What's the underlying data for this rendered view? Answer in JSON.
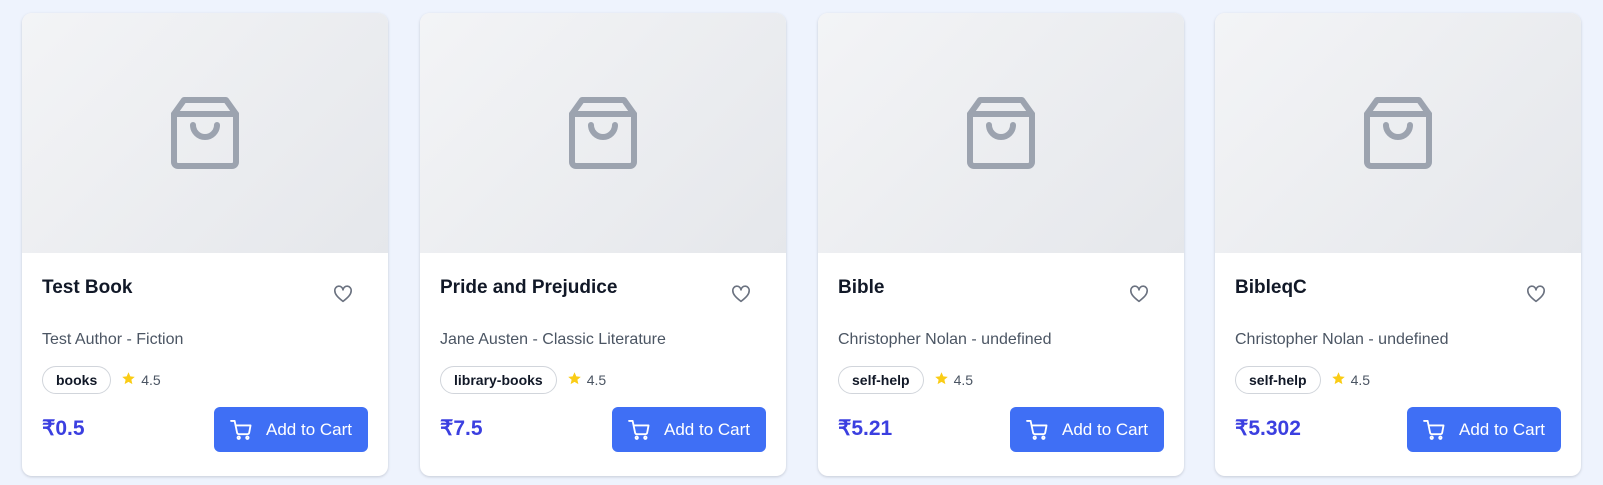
{
  "colors": {
    "page_background": "#eef3fd",
    "accent": "#3f6ff5",
    "price": "#3b3fe0",
    "star": "#facc15",
    "placeholder_icon": "#9ca3af"
  },
  "icons": {
    "placeholder": "shopping-bag-icon",
    "favorite": "heart-icon",
    "rating": "star-icon",
    "cart": "cart-icon"
  },
  "products": [
    {
      "title": "Test Book",
      "subtitle": "Test Author - Fiction",
      "category": "books",
      "rating": "4.5",
      "price": "₹0.5",
      "button_label": "Add to Cart"
    },
    {
      "title": "Pride and Prejudice",
      "subtitle": "Jane Austen - Classic Literature",
      "category": "library-books",
      "rating": "4.5",
      "price": "₹7.5",
      "button_label": "Add to Cart"
    },
    {
      "title": "Bible",
      "subtitle": "Christopher Nolan - undefined",
      "category": "self-help",
      "rating": "4.5",
      "price": "₹5.21",
      "button_label": "Add to Cart"
    },
    {
      "title": "BibleqC",
      "subtitle": "Christopher Nolan - undefined",
      "category": "self-help",
      "rating": "4.5",
      "price": "₹5.302",
      "button_label": "Add to Cart"
    }
  ]
}
